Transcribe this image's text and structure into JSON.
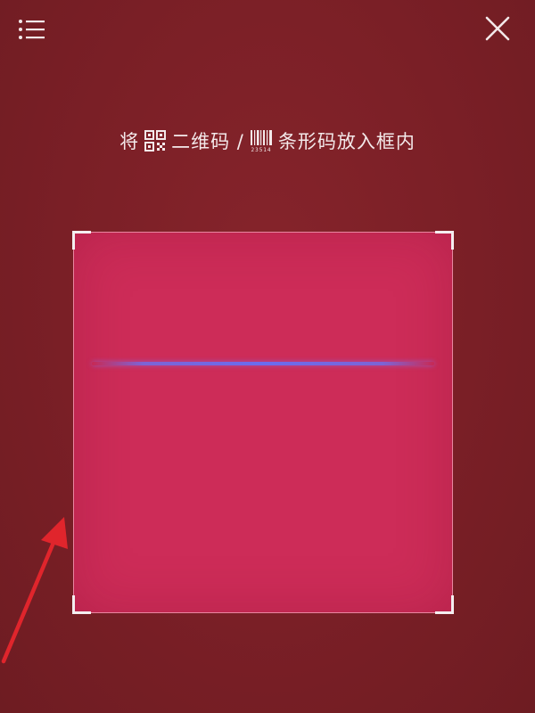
{
  "header": {
    "menu_icon": "list-menu-icon",
    "close_icon": "close-icon"
  },
  "hint": {
    "prefix": "将",
    "qr_label": "二维码 /",
    "barcode_label": "条形码放入框内",
    "qr_icon": "qr-code-icon",
    "barcode_icon": "barcode-icon",
    "barcode_digits": "23514"
  },
  "scanner": {
    "scan_line_color": "#6a6cf0",
    "frame_color": "#cd2c58"
  },
  "annotation": {
    "arrow_color": "#e0252c"
  }
}
